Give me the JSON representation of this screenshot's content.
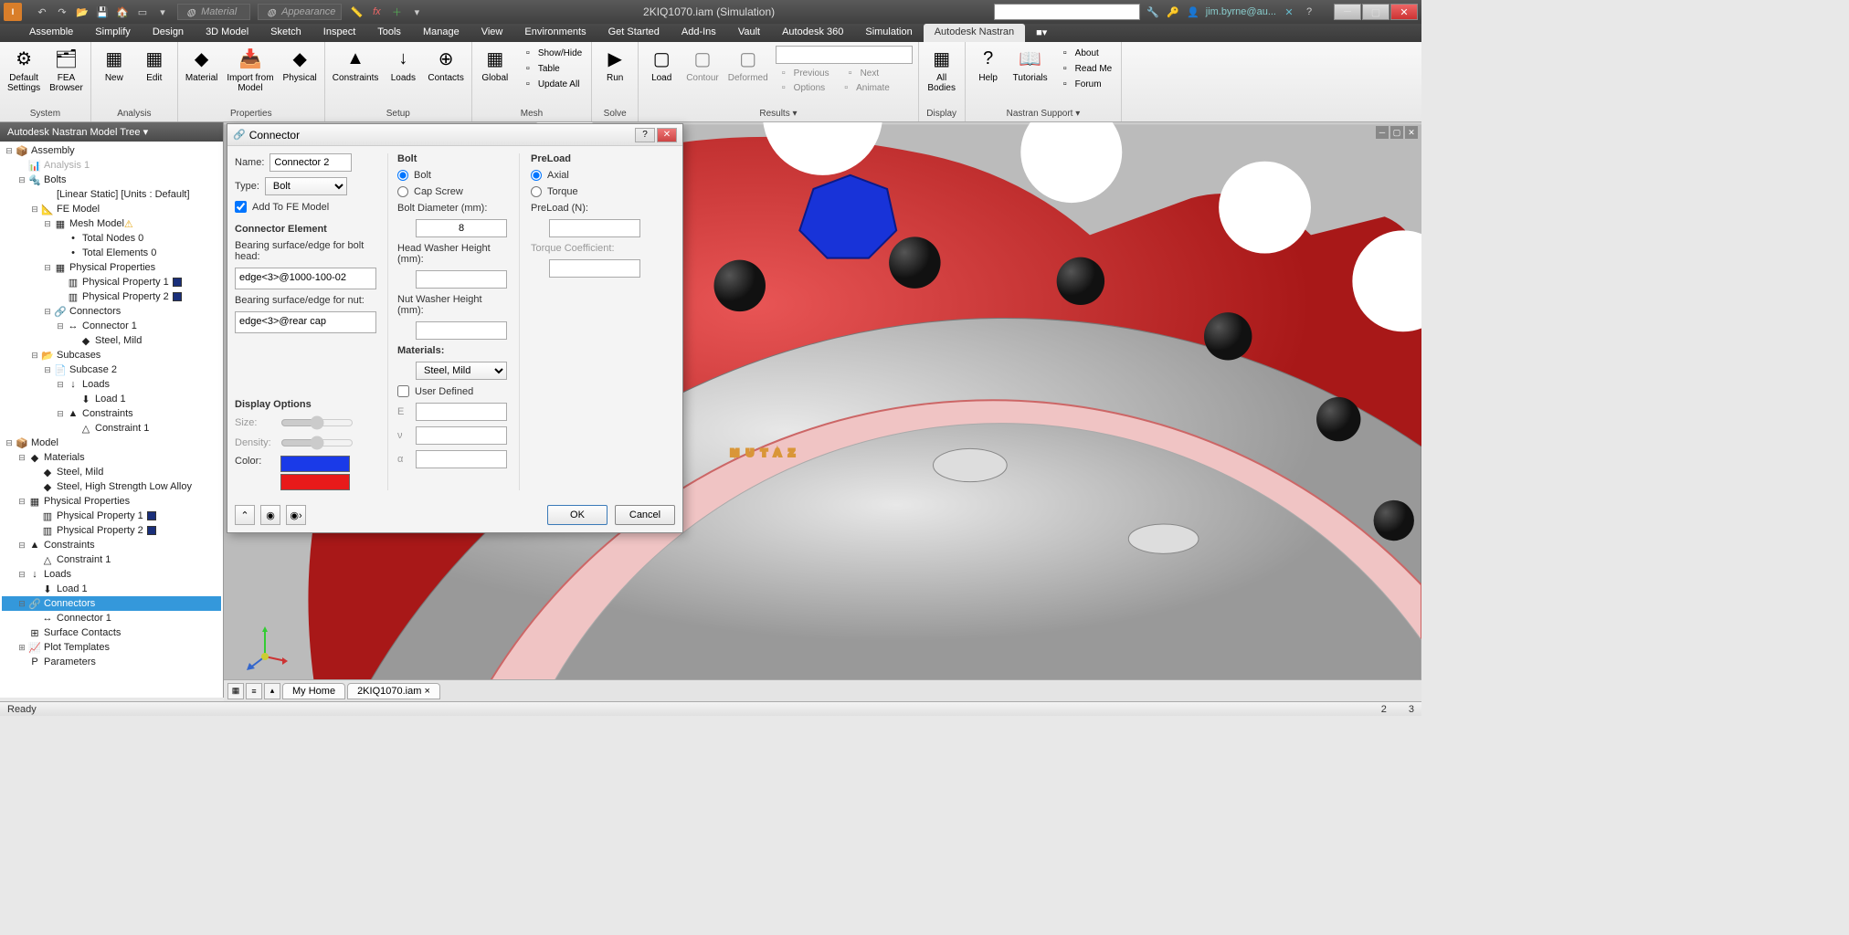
{
  "title": "2KIQ1070.iam (Simulation)",
  "user": "jim.byrne@au...",
  "material_dd": "Material",
  "appearance_dd": "Appearance",
  "ribbon_tabs": [
    "Assemble",
    "Simplify",
    "Design",
    "3D Model",
    "Sketch",
    "Inspect",
    "Tools",
    "Manage",
    "View",
    "Environments",
    "Get Started",
    "Add-Ins",
    "Vault",
    "Autodesk 360",
    "Simulation",
    "Autodesk Nastran"
  ],
  "active_tab": 15,
  "groups": {
    "system": {
      "title": "System",
      "btns": [
        {
          "label": "Default\nSettings"
        },
        {
          "label": "FEA\nBrowser"
        }
      ]
    },
    "analysis": {
      "title": "Analysis",
      "btns": [
        {
          "label": "New"
        },
        {
          "label": "Edit"
        }
      ]
    },
    "properties": {
      "title": "Properties",
      "btns": [
        {
          "label": "Material"
        },
        {
          "label": "Import from\nModel"
        },
        {
          "label": "Physical"
        }
      ]
    },
    "setup": {
      "title": "Setup",
      "btns": [
        {
          "label": "Constraints"
        },
        {
          "label": "Loads"
        },
        {
          "label": "Contacts"
        }
      ]
    },
    "mesh": {
      "title": "Mesh",
      "btns": [
        {
          "label": "Global"
        }
      ],
      "small": [
        {
          "label": "Show/Hide"
        },
        {
          "label": "Table"
        },
        {
          "label": "Update All"
        }
      ]
    },
    "solve": {
      "title": "Solve",
      "btns": [
        {
          "label": "Run"
        }
      ]
    },
    "results": {
      "title": "Results ▾",
      "btns": [
        {
          "label": "Load"
        },
        {
          "label": "Contour",
          "disabled": true
        },
        {
          "label": "Deformed",
          "disabled": true
        }
      ],
      "small": [
        {
          "label": "Previous",
          "disabled": true
        },
        {
          "label": "Next",
          "disabled": true
        },
        {
          "label": "Options",
          "disabled": true
        },
        {
          "label": "Animate",
          "disabled": true
        }
      ]
    },
    "display": {
      "title": "Display",
      "btns": [
        {
          "label": "All\nBodies"
        }
      ]
    },
    "support": {
      "title": "Nastran Support ▾",
      "btns": [
        {
          "label": "Help"
        },
        {
          "label": "Tutorials"
        }
      ],
      "small": [
        {
          "label": "About"
        },
        {
          "label": "Read Me"
        },
        {
          "label": "Forum"
        }
      ]
    }
  },
  "tree_header": "Autodesk Nastran Model Tree ▾",
  "tree": [
    {
      "d": 0,
      "t": "-",
      "i": "📦",
      "l": "Assembly"
    },
    {
      "d": 1,
      "t": "",
      "i": "📊",
      "l": "Analysis 1",
      "dim": true
    },
    {
      "d": 1,
      "t": "-",
      "i": "🔩",
      "l": "Bolts"
    },
    {
      "d": 2,
      "t": "",
      "i": "",
      "l": "[Linear Static] [Units : Default]"
    },
    {
      "d": 2,
      "t": "-",
      "i": "📐",
      "l": "FE Model"
    },
    {
      "d": 3,
      "t": "-",
      "i": "▦",
      "l": "Mesh Model",
      "warn": true
    },
    {
      "d": 4,
      "t": "",
      "i": "•",
      "l": "Total Nodes 0"
    },
    {
      "d": 4,
      "t": "",
      "i": "•",
      "l": "Total Elements 0"
    },
    {
      "d": 3,
      "t": "-",
      "i": "▦",
      "l": "Physical Properties"
    },
    {
      "d": 4,
      "t": "",
      "i": "▥",
      "l": "Physical Property 1",
      "sw": "#1a2f7a"
    },
    {
      "d": 4,
      "t": "",
      "i": "▥",
      "l": "Physical Property 2",
      "sw": "#1a2f7a"
    },
    {
      "d": 3,
      "t": "-",
      "i": "🔗",
      "l": "Connectors"
    },
    {
      "d": 4,
      "t": "-",
      "i": "↔",
      "l": "Connector 1"
    },
    {
      "d": 5,
      "t": "",
      "i": "◆",
      "l": "Steel, Mild"
    },
    {
      "d": 2,
      "t": "-",
      "i": "📂",
      "l": "Subcases"
    },
    {
      "d": 3,
      "t": "-",
      "i": "📄",
      "l": "Subcase 2"
    },
    {
      "d": 4,
      "t": "-",
      "i": "↓",
      "l": "Loads"
    },
    {
      "d": 5,
      "t": "",
      "i": "⬇",
      "l": "Load 1"
    },
    {
      "d": 4,
      "t": "-",
      "i": "▲",
      "l": "Constraints"
    },
    {
      "d": 5,
      "t": "",
      "i": "△",
      "l": "Constraint 1"
    },
    {
      "d": 0,
      "t": "-",
      "i": "📦",
      "l": "Model"
    },
    {
      "d": 1,
      "t": "-",
      "i": "◆",
      "l": "Materials"
    },
    {
      "d": 2,
      "t": "",
      "i": "◆",
      "l": "Steel, Mild"
    },
    {
      "d": 2,
      "t": "",
      "i": "◆",
      "l": "Steel, High Strength Low Alloy"
    },
    {
      "d": 1,
      "t": "-",
      "i": "▦",
      "l": "Physical Properties"
    },
    {
      "d": 2,
      "t": "",
      "i": "▥",
      "l": "Physical Property 1",
      "sw": "#1a2f7a"
    },
    {
      "d": 2,
      "t": "",
      "i": "▥",
      "l": "Physical Property 2",
      "sw": "#1a2f7a"
    },
    {
      "d": 1,
      "t": "-",
      "i": "▲",
      "l": "Constraints"
    },
    {
      "d": 2,
      "t": "",
      "i": "△",
      "l": "Constraint 1"
    },
    {
      "d": 1,
      "t": "-",
      "i": "↓",
      "l": "Loads"
    },
    {
      "d": 2,
      "t": "",
      "i": "⬇",
      "l": "Load 1"
    },
    {
      "d": 1,
      "t": "-",
      "i": "🔗",
      "l": "Connectors",
      "sel": true
    },
    {
      "d": 2,
      "t": "",
      "i": "↔",
      "l": "Connector 1"
    },
    {
      "d": 1,
      "t": "",
      "i": "⊞",
      "l": "Surface Contacts"
    },
    {
      "d": 1,
      "t": "+",
      "i": "📈",
      "l": "Plot Templates"
    },
    {
      "d": 1,
      "t": "",
      "i": "P",
      "l": "Parameters"
    }
  ],
  "dialog": {
    "title": "Connector",
    "name_lbl": "Name:",
    "name_val": "Connector 2",
    "type_lbl": "Type:",
    "type_val": "Bolt",
    "add_fe": "Add To FE Model",
    "add_fe_checked": true,
    "conn_elem": "Connector Element",
    "bearing_head": "Bearing surface/edge for bolt head:",
    "bearing_head_val": "edge<3>@1000-100-02",
    "bearing_nut": "Bearing surface/edge for nut:",
    "bearing_nut_val": "edge<3>@rear cap",
    "display_opts": "Display Options",
    "size_lbl": "Size:",
    "density_lbl": "Density:",
    "color_lbl": "Color:",
    "color1": "#1a3ae8",
    "color2": "#e81a1a",
    "bolt_hdr": "Bolt",
    "bolt_radio": "Bolt",
    "capscrew_radio": "Cap Screw",
    "bolt_diam": "Bolt Diameter (mm):",
    "bolt_diam_val": "8",
    "head_washer": "Head Washer Height (mm):",
    "nut_washer": "Nut Washer Height (mm):",
    "materials_lbl": "Materials:",
    "materials_val": "Steel, Mild",
    "user_defined": "User Defined",
    "e_lbl": "E",
    "nu_lbl": "ν",
    "alpha_lbl": "α",
    "preload_hdr": "PreLoad",
    "axial_radio": "Axial",
    "torque_radio": "Torque",
    "preload_n": "PreLoad (N):",
    "torque_coef": "Torque Coefficient:",
    "ok": "OK",
    "cancel": "Cancel"
  },
  "doc_tabs": {
    "home": "My Home",
    "file": "2KIQ1070.iam"
  },
  "status": {
    "ready": "Ready",
    "n1": "2",
    "n2": "3"
  }
}
